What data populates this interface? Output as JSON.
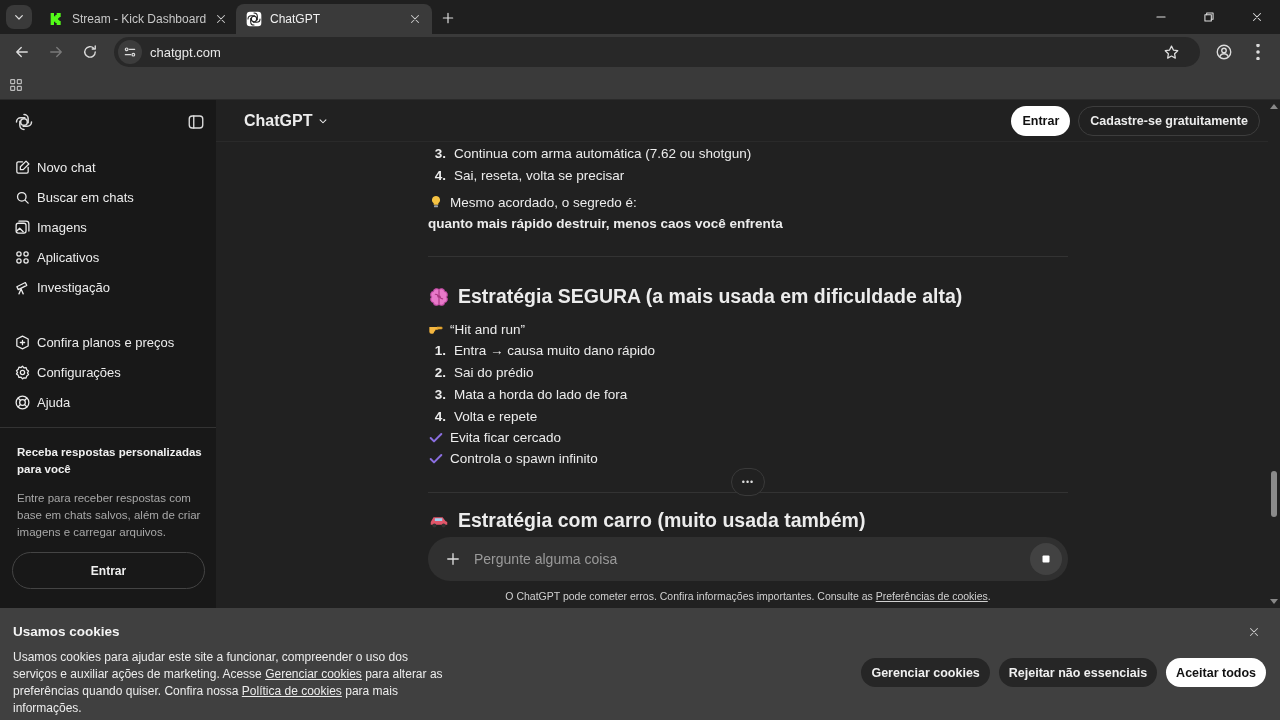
{
  "browser": {
    "tabs": [
      {
        "title": "Stream - Kick Dashboard",
        "selected": false
      },
      {
        "title": "ChatGPT",
        "selected": true
      }
    ],
    "address": "chatgpt.com"
  },
  "sidebar": {
    "items": [
      {
        "label": "Novo chat"
      },
      {
        "label": "Buscar em chats"
      },
      {
        "label": "Imagens"
      },
      {
        "label": "Aplicativos"
      },
      {
        "label": "Investigação"
      }
    ],
    "secondary_items": [
      {
        "label": "Confira planos e preços"
      },
      {
        "label": "Configurações"
      },
      {
        "label": "Ajuda"
      }
    ],
    "promo": {
      "title": "Receba respostas personalizadas para você",
      "text": "Entre para receber respostas com base em chats salvos, além de criar imagens e carregar arquivos.",
      "button": "Entrar"
    }
  },
  "header": {
    "title": "ChatGPT",
    "buttons": [
      {
        "label": "Entrar",
        "kind": "primary"
      },
      {
        "label": "Cadastre-se gratuitamente",
        "kind": "secondary"
      }
    ]
  },
  "message": [
    {
      "kind": "ordered",
      "items": [
        {
          "number": "3.",
          "text": "Continua com arma automática (7.62 ou shotgun)"
        },
        {
          "number": "4.",
          "text": "Sai, reseta, volta se precisar"
        }
      ]
    },
    {
      "kind": "tip",
      "text": "Mesmo acordado, o segredo é:"
    },
    {
      "kind": "bold",
      "text": "quanto mais rápido destruir, menos caos você enfrenta"
    },
    {
      "kind": "divider"
    },
    {
      "kind": "heading",
      "text": "Estratégia SEGURA (a mais usada em dificuldade alta)"
    },
    {
      "kind": "pointer",
      "text": "“Hit and run”"
    },
    {
      "kind": "ordered",
      "items": [
        {
          "number": "1.",
          "text": "Entra → causa muito dano rápido"
        },
        {
          "number": "2.",
          "text": "Sai do prédio"
        },
        {
          "number": "3.",
          "text": "Mata a horda do lado de fora"
        },
        {
          "number": "4.",
          "text": "Volta e repete"
        }
      ]
    },
    {
      "kind": "checks",
      "items": [
        "Evita ficar cercado",
        "Controla o spawn infinito"
      ]
    },
    {
      "kind": "more_divider",
      "label": "•••"
    },
    {
      "kind": "heading",
      "text": "Estratégia com carro (muito usada também)"
    }
  ],
  "composer": {
    "placeholder": "Pergunte alguma coisa",
    "disclaimer": "O ChatGPT pode cometer erros. Confira informações importantes. Consulte as ",
    "link": "Preferências de cookies",
    "end": "."
  },
  "cookies": {
    "title": "Usamos cookies",
    "text": [
      {
        "text": "Usamos cookies para ajudar este site a funcionar, compreender o uso dos serviços e auxiliar ações de marketing. Acesse "
      },
      {
        "link": "Gerenciar cookies"
      },
      {
        "text": " para alterar as preferências quando quiser. Confira nossa "
      },
      {
        "link": "Política de cookies"
      },
      {
        "text": " para mais informações."
      }
    ],
    "buttons": [
      {
        "label": "Gerenciar cookies",
        "kind": "secondary"
      },
      {
        "label": "Rejeitar não essenciais",
        "kind": "secondary"
      },
      {
        "label": "Aceitar todos",
        "kind": "primary"
      }
    ]
  }
}
